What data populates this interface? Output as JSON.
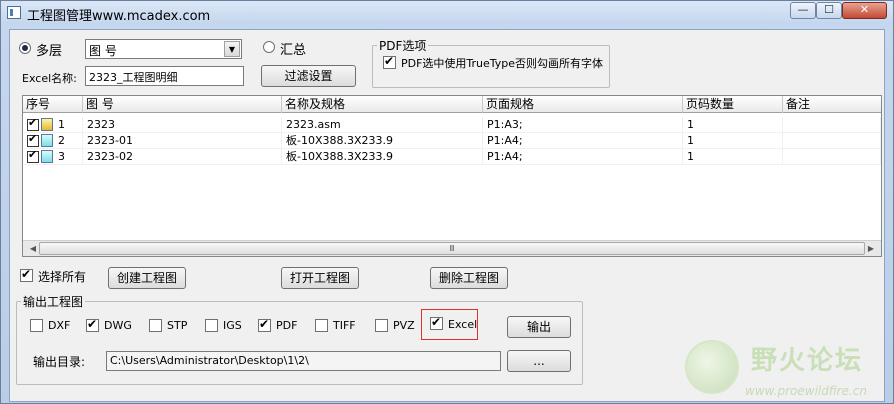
{
  "window": {
    "title": "工程图管理www.mcadex.com",
    "controls": {
      "minimize": "—",
      "maximize": "☐",
      "close": "✕"
    }
  },
  "top": {
    "radio_multilayer": {
      "label": "多层",
      "selected": true
    },
    "combo_value": "图 号",
    "radio_summary": {
      "label": "汇总",
      "selected": false
    },
    "excel_name_label": "Excel名称:",
    "excel_name_value": "2323_工程图明细",
    "filter_button": "过滤设置",
    "pdf_group": {
      "legend": "PDF选项",
      "truetype_checkbox": {
        "label": "PDF选中使用TrueType否则勾画所有字体",
        "checked": true
      }
    }
  },
  "table": {
    "columns": [
      "序号",
      "图 号",
      "名称及规格",
      "页面规格",
      "页码数量",
      "备注"
    ],
    "rows": [
      {
        "seq": "1",
        "drawing_no": "2323",
        "name_spec": "2323.asm",
        "page_spec": "P1:A3;",
        "page_count": "1",
        "remark": "",
        "checked": true,
        "icon": "assembly-icon"
      },
      {
        "seq": "2",
        "drawing_no": "2323-01",
        "name_spec": "板-10X388.3X233.9",
        "page_spec": "P1:A4;",
        "page_count": "1",
        "remark": "",
        "checked": true,
        "icon": "part-icon"
      },
      {
        "seq": "3",
        "drawing_no": "2323-02",
        "name_spec": "板-10X388.3X233.9",
        "page_spec": "P1:A4;",
        "page_count": "1",
        "remark": "",
        "checked": true,
        "icon": "part-icon"
      }
    ],
    "scrollbar": {
      "left": "◀",
      "right": "▶",
      "grip": "Ⅲ"
    }
  },
  "actions": {
    "select_all": {
      "label": "选择所有",
      "checked": true
    },
    "create_button": "创建工程图",
    "open_button": "打开工程图",
    "delete_button": "删除工程图"
  },
  "output": {
    "legend": "输出工程图",
    "formats": [
      {
        "label": "DXF",
        "checked": false
      },
      {
        "label": "DWG",
        "checked": true
      },
      {
        "label": "STP",
        "checked": false
      },
      {
        "label": "IGS",
        "checked": false
      },
      {
        "label": "PDF",
        "checked": true
      },
      {
        "label": "TIFF",
        "checked": false
      },
      {
        "label": "PVZ",
        "checked": false
      },
      {
        "label": "Excel",
        "checked": true
      }
    ],
    "export_button": "输出",
    "dir_label": "输出目录:",
    "dir_value": "C:\\Users\\Administrator\\Desktop\\1\\2\\",
    "browse_button": "..."
  },
  "watermark": {
    "text": "野火论坛",
    "url": "www.proewildfire.cn"
  }
}
